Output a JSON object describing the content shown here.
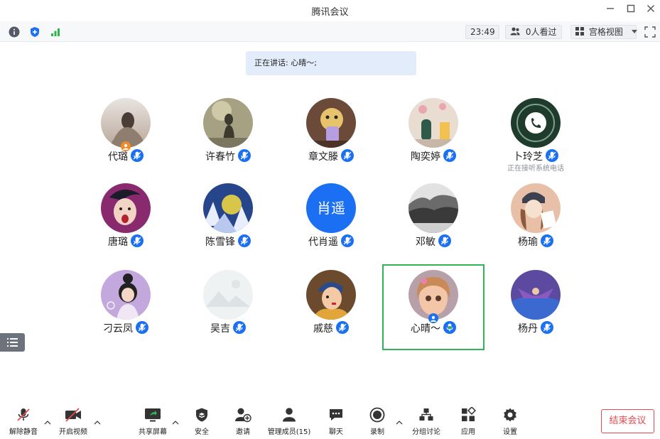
{
  "window": {
    "title": "腾讯会议"
  },
  "status": {
    "time": "23:49",
    "viewers": "0人看过",
    "view_mode": "宫格视图"
  },
  "speaking": {
    "text": "正在讲话: 心晴～;"
  },
  "participants": [
    {
      "name": "代璐",
      "sub": ""
    },
    {
      "name": "许春竹",
      "sub": ""
    },
    {
      "name": "章文滕",
      "sub": ""
    },
    {
      "name": "陶奕婷",
      "sub": ""
    },
    {
      "name": "卜玲芝",
      "sub": "正在接听系统电话"
    },
    {
      "name": "唐璐",
      "sub": ""
    },
    {
      "name": "陈雪锋",
      "sub": ""
    },
    {
      "name": "代肖遥",
      "sub": "",
      "avatar_text": "肖遥"
    },
    {
      "name": "邓敏",
      "sub": ""
    },
    {
      "name": "杨瑜",
      "sub": ""
    },
    {
      "name": "刁云凤",
      "sub": ""
    },
    {
      "name": "吴吉",
      "sub": ""
    },
    {
      "name": "戚慈",
      "sub": ""
    },
    {
      "name": "心晴～",
      "sub": ""
    },
    {
      "name": "杨丹",
      "sub": ""
    }
  ],
  "toolbar": {
    "unmute": "解除静音",
    "start_video": "开启视频",
    "share_screen": "共享屏幕",
    "security": "安全",
    "invite": "邀请",
    "manage_members": "管理成员(15)",
    "chat": "聊天",
    "record": "录制",
    "breakout": "分组讨论",
    "apps": "应用",
    "settings": "设置",
    "end_meeting": "结束会议"
  },
  "colors": {
    "accent": "#1a6ff2",
    "active_border": "#34b25a",
    "end_red": "#e5484d"
  }
}
